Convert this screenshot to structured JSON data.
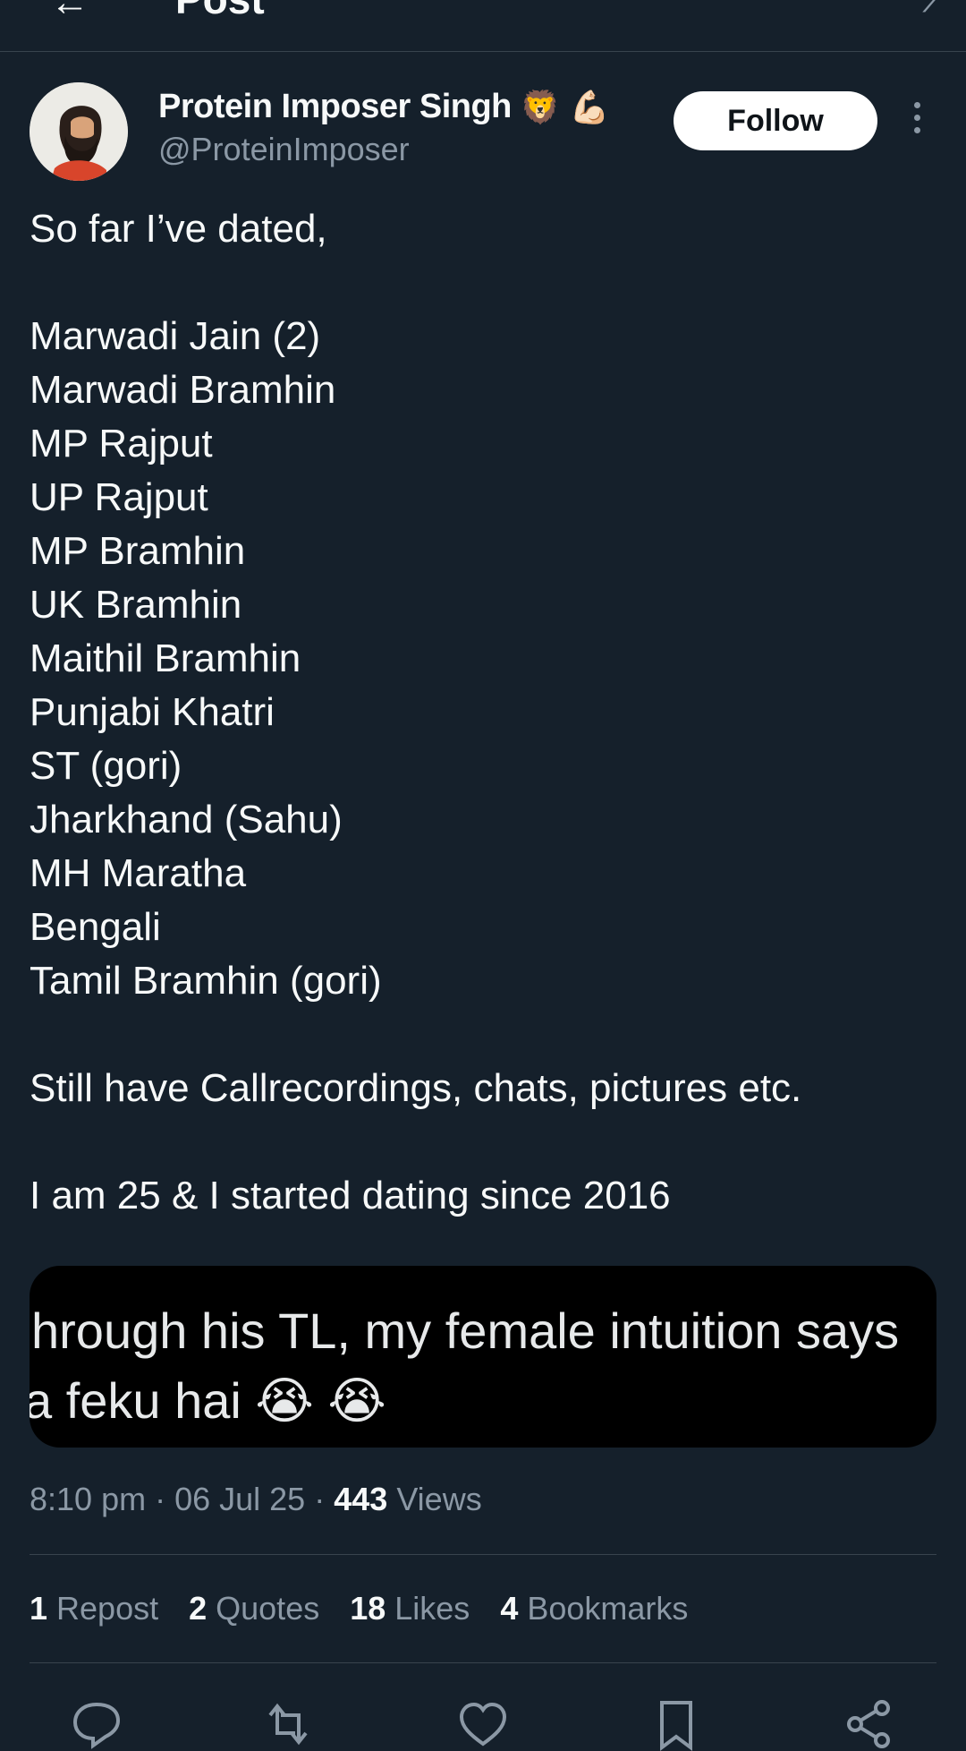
{
  "header": {
    "back_icon": "arrow-left-icon",
    "title": "Post"
  },
  "author": {
    "name": "Protein Imposer Singh",
    "emojis": [
      "🦁",
      "💪🏻"
    ],
    "handle": "@ProteinImposer",
    "follow_label": "Follow"
  },
  "tweet": {
    "text": "So far I’ve dated,\n\nMarwadi Jain (2)\nMarwadi Bramhin\nMP Rajput\nUP Rajput\nMP Bramhin\nUK Bramhin\nMaithil Bramhin\nPunjabi Khatri\nST (gori)\nJharkhand (Sahu)\nMH Maratha\nBengali\nTamil Bramhin (gori)\n\nStill have Callrecordings, chats, pictures etc.\n\nI am 25 & I started dating since 2016"
  },
  "media": {
    "line1": "hrough his TL, my female intuition says",
    "line2": "a feku hai 😭 😭"
  },
  "meta": {
    "time": "8:10 pm",
    "date": "06 Jul 25",
    "views_count": "443",
    "views_label": "Views"
  },
  "stats": {
    "reposts_count": "1",
    "reposts_label": "Repost",
    "quotes_count": "2",
    "quotes_label": "Quotes",
    "likes_count": "18",
    "likes_label": "Likes",
    "bookmarks_count": "4",
    "bookmarks_label": "Bookmarks"
  },
  "actions": [
    "reply-icon",
    "repost-icon",
    "like-icon",
    "bookmark-icon",
    "share-icon"
  ],
  "colors": {
    "background": "#15202b",
    "text": "#f7f9f9",
    "muted": "#8b98a5",
    "divider": "#38444d"
  }
}
